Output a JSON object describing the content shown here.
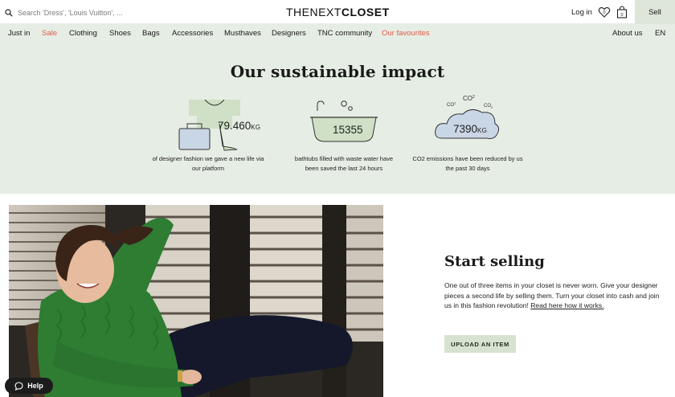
{
  "search": {
    "placeholder": "Search 'Dress', 'Louis Vuitton', ..."
  },
  "brand": {
    "logo_thin": "THENEXT",
    "logo_bold": "CLOSET"
  },
  "header": {
    "login": "Log in",
    "wishlist_count": "0",
    "bag_count": "0",
    "sell": "Sell"
  },
  "nav": {
    "items": [
      "Just in",
      "Sale",
      "Clothing",
      "Shoes",
      "Bags",
      "Accessories",
      "Musthaves",
      "Designers",
      "TNC community",
      "Our favourites"
    ],
    "about": "About us",
    "lang": "EN"
  },
  "impact": {
    "title": "Our sustainable impact",
    "stats": [
      {
        "value": "79.460",
        "unit": "KG",
        "caption": "of designer fashion we gave a new life via our platform"
      },
      {
        "value": "15355",
        "unit": "",
        "caption": "bathtubs filled with waste water have been saved the last 24 hours"
      },
      {
        "value": "7390",
        "unit": "KG",
        "caption": "CO2 emissions have been reduced by us the past 30 days"
      }
    ],
    "co2_labels": [
      "CO",
      "2",
      "CO",
      "2",
      "CO",
      "2"
    ]
  },
  "selling": {
    "title": "Start selling",
    "body": "One out of three items in your closet is never worn. Give your designer pieces a second life by selling them. Turn your closet into cash and join us in this fashion revolution!",
    "link": "Read here how it works.",
    "button": "UPLOAD AN ITEM"
  },
  "help": {
    "label": "Help"
  },
  "colors": {
    "mint": "#e6ede4",
    "sale_red": "#e15b4a",
    "cloud": "#c9d6e6",
    "tub": "#cfe0c6"
  }
}
